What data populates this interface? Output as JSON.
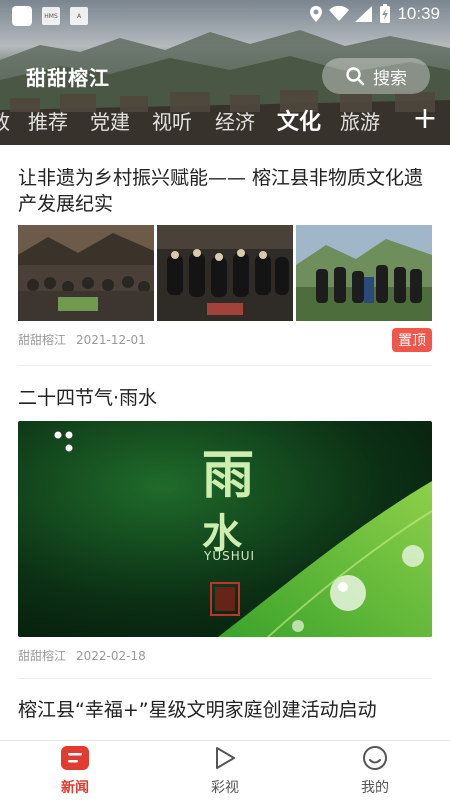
{
  "status_bar": {
    "time": "10:39"
  },
  "header": {
    "brand": "甜甜榕江",
    "search_label": "搜索",
    "tabs": [
      "政",
      "推荐",
      "党建",
      "视听",
      "经济",
      "文化",
      "旅游"
    ],
    "active_tab": "文化"
  },
  "feed": {
    "articles": [
      {
        "title": "让非遗为乡村振兴赋能—— 榕江县非物质文化遗产发展纪实",
        "source": "甜甜榕江",
        "date": "2021-12-01",
        "badge": "置顶"
      },
      {
        "title": "二十四节气·雨水",
        "source": "甜甜榕江",
        "date": "2022-02-18",
        "image_text": {
          "big": "雨",
          "second": "水",
          "pinyin": "YUSHUI"
        }
      },
      {
        "title": "榕江县“幸福+”星级文明家庭创建活动启动"
      }
    ]
  },
  "bottom_nav": {
    "items": [
      {
        "label": "新闻",
        "icon": "news-icon"
      },
      {
        "label": "彩视",
        "icon": "play-icon"
      },
      {
        "label": "我的",
        "icon": "smiley-icon"
      }
    ],
    "active": "新闻"
  },
  "colors": {
    "accent": "#e03c31",
    "badge": "#f0564a"
  }
}
